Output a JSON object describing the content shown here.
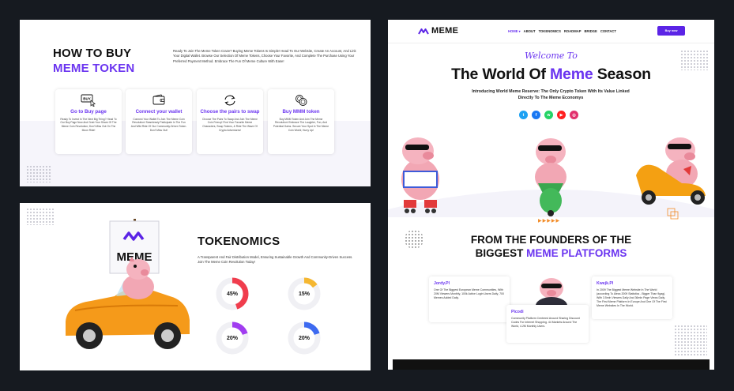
{
  "howto": {
    "title_line1": "HOW TO BUY",
    "title_line2": "MEME TOKEN",
    "description": "Ready To Join The Meme Token Craze? Buying Meme Tokens Is Simple! Head To Our Website, Create An Account, And Link Your Digital Wallet. Browse Our Selection Of Meme Tokens, Choose Your Favorite, And Complete The Purchase Using Your Preferred Payment Method. Embrace The Fun Of Meme Culture With Ease!",
    "cards": [
      {
        "icon": "buy-cursor-icon",
        "icon_text": "BUY",
        "title": "Go to Buy page",
        "desc": "Ready To Invest In The Next Big Thing? Head To Our Buy Page Now And Grab Your Share Of The Meme Coin Revolution; Don't Miss Out On The Moon Ride!"
      },
      {
        "icon": "wallet-icon",
        "title": "Connect your wallet",
        "desc": "Connect Your Wallet To Join The Meme Coin Revolution! Seamlessly Participate In The Fun And Wild Ride Of Our Community-Driven Token. Don't Miss Out!"
      },
      {
        "icon": "swap-arrows-icon",
        "title": "Choose the pairs to swap",
        "desc": "Choose The Pairs To Swap And Join The Meme Coin Frenzy! Find Your Favorite Meme Characters, Swap Tokens, & Ride The Wave Of Crypto Adventures!"
      },
      {
        "icon": "coins-icon",
        "title": "Buy MMM token",
        "desc": "Buy MMM Token And Join The Meme Revolution! Embrace The Laughter, Fun, And Potential Gains. Secure Your Spot In The Meme Coin World; Hurry Up!"
      }
    ]
  },
  "tokenomics": {
    "sign_text": "MEME",
    "title": "TOKENOMICS",
    "description": "A Transparent And Fair Distribution Model, Ensuring Sustainable Growth And Community-Driven Success. Join The Meme Coin Revolution Today!",
    "donuts": [
      {
        "label": "45%",
        "value": 45,
        "color": "#f03d4d"
      },
      {
        "label": "15%",
        "value": 15,
        "color": "#f5b731"
      },
      {
        "label": "20%",
        "value": 20,
        "color": "#a13df0"
      },
      {
        "label": "20%",
        "value": 20,
        "color": "#3d6af0"
      }
    ]
  },
  "site": {
    "logo": "MEME",
    "menu": [
      "HOME",
      "ABOUT",
      "TOKENOMICS",
      "ROADMAP",
      "BRIDGE",
      "CONTACT"
    ],
    "buy_button": "Buy now",
    "welcome": "Welcome To",
    "hero_prefix": "The World Of ",
    "hero_accent": "Meme",
    "hero_suffix": " Season",
    "intro": "Introducing World Meme Reserve: The Only Crypto Token With Its Value Linked Directly To The Meme Economys",
    "socials": [
      {
        "icon": "twitter-icon",
        "glyph": "t",
        "color": "#1da1f2"
      },
      {
        "icon": "facebook-icon",
        "glyph": "f",
        "color": "#1877f2"
      },
      {
        "icon": "whatsapp-icon",
        "glyph": "w",
        "color": "#25d366"
      },
      {
        "icon": "youtube-icon",
        "glyph": "▶",
        "color": "#ff1f1f"
      },
      {
        "icon": "instagram-icon",
        "glyph": "◎",
        "color": "#e1306c"
      }
    ],
    "arrows": "▶▶▶▶▶",
    "founders_line1": "FROM THE FOUNDERS OF THE",
    "founders_line2_prefix": "BIGGEST ",
    "founders_line2_accent": "MEME PLATFORMS",
    "founders": [
      {
        "name": "Jordy.Pl",
        "desc": "One Of The Biggest European Meme Communities, With 20M Viewers Monthly, 100k Active Login Users Daily, 700 Memes Added Daily."
      },
      {
        "name": "Picodi",
        "desc": "Community Platform Centered Around Sharing Discount Codes For Internet Shopping. 44 Markets Around The World, 4.2M Monthly Users."
      },
      {
        "name": "Kwejk.Pl",
        "desc": "In 2009 The Biggest Meme Website In The World (according To Alexa 2009 Statistics - Bigger Than 9gag). With 3.5mln Viewers Daily And 36mln Page Views Daily. The First Meme Platform In Europe And One Of The First Meme Websites In The World."
      }
    ]
  }
}
